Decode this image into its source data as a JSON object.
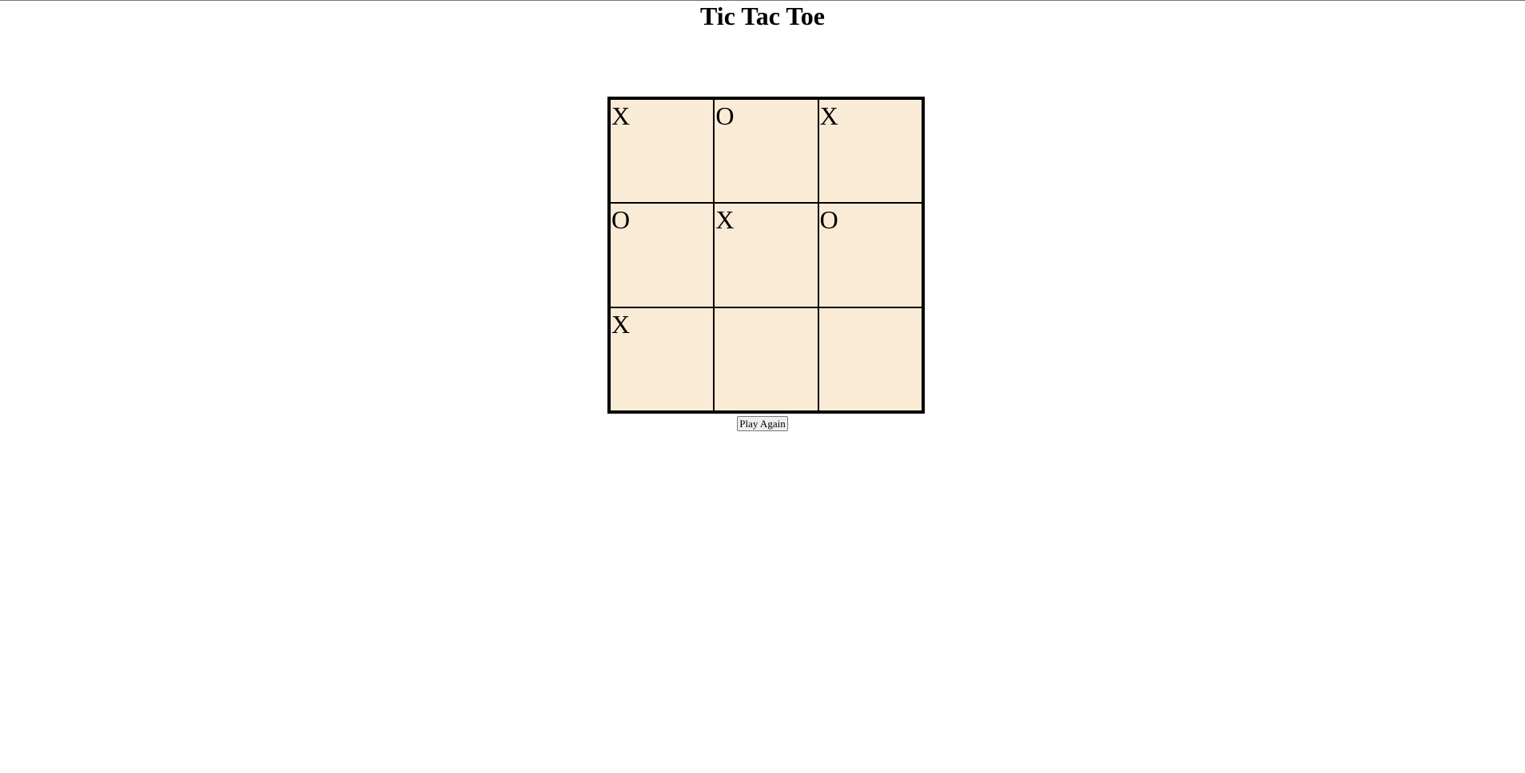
{
  "page": {
    "title": "Tic Tac Toe"
  },
  "board": {
    "cells": [
      "X",
      "O",
      "X",
      "O",
      "X",
      "O",
      "X",
      "",
      ""
    ],
    "cell_color": "#faebd7",
    "border_color": "#000000"
  },
  "controls": {
    "play_again_label": "Play Again"
  }
}
